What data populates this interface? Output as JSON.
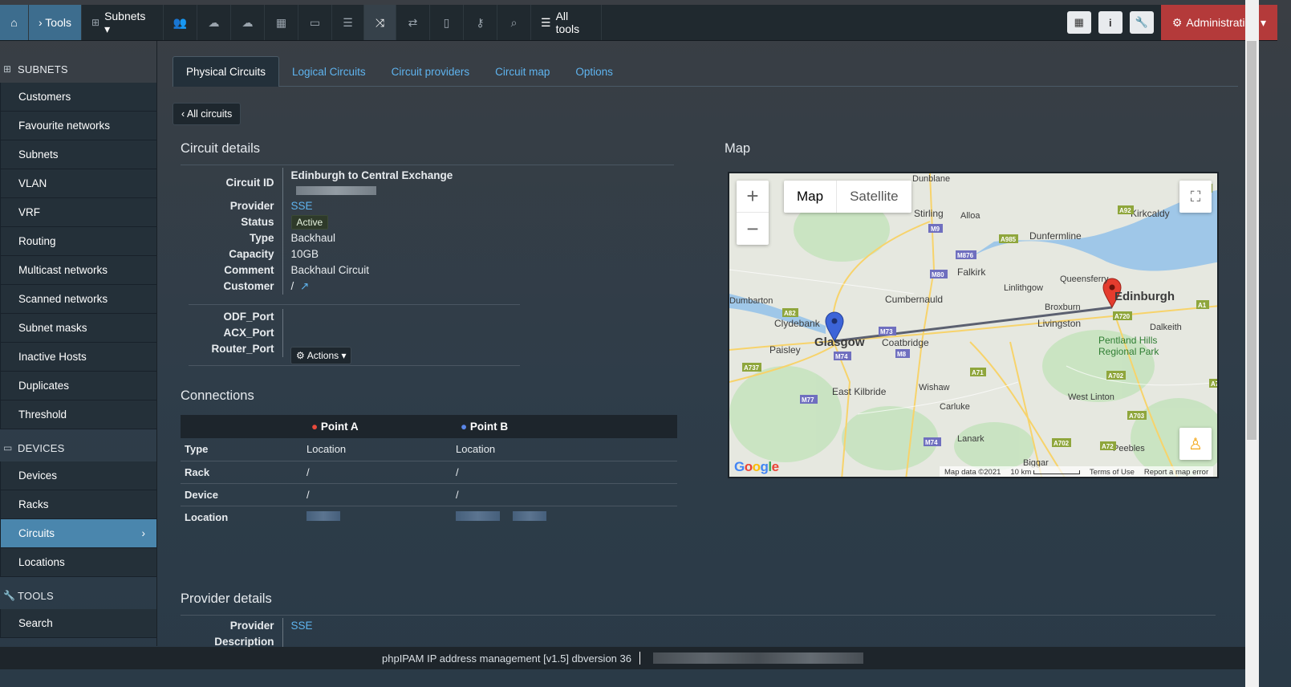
{
  "topbar": {
    "home_icon": "home-icon",
    "tools_label": "› Tools",
    "subnets_label": "Subnets ▾",
    "all_tools_label": "All tools",
    "admin_label": "Administration ▾",
    "icons": [
      "users-icon",
      "cloud-icon",
      "cloud-icon",
      "map-icon",
      "desktop-icon",
      "list-icon",
      "shuffle-icon",
      "exchange-icon",
      "map-outline-icon",
      "key-icon",
      "search-icon"
    ]
  },
  "sidebar": {
    "subnets_section": "SUBNETS",
    "subnets_items": [
      "Customers",
      "Favourite networks",
      "Subnets",
      "VLAN",
      "VRF",
      "Routing",
      "Multicast networks",
      "Scanned networks",
      "Subnet masks",
      "Inactive Hosts",
      "Duplicates",
      "Threshold"
    ],
    "devices_section": "DEVICES",
    "devices_items": [
      "Devices",
      "Racks",
      "Circuits",
      "Locations"
    ],
    "tools_section": "TOOLS",
    "tools_items": [
      "Search"
    ]
  },
  "tabs": [
    "Physical Circuits",
    "Logical Circuits",
    "Circuit providers",
    "Circuit map",
    "Options"
  ],
  "back_label": "‹ All circuits",
  "circuit": {
    "heading": "Circuit details",
    "labels": {
      "id": "Circuit ID",
      "provider": "Provider",
      "status": "Status",
      "type": "Type",
      "capacity": "Capacity",
      "comment": "Comment",
      "customer": "Customer",
      "odf": "ODF_Port",
      "acx": "ACX_Port",
      "router": "Router_Port"
    },
    "id": "Edinburgh to Central Exchange",
    "provider": "SSE",
    "status": "Active",
    "type": "Backhaul",
    "capacity": "10GB",
    "comment": "Backhaul Circuit",
    "customer": "/",
    "actions_label": "Actions ▾"
  },
  "connections": {
    "heading": "Connections",
    "point_a": "Point A",
    "point_b": "Point B",
    "rows": [
      {
        "label": "Type",
        "a": "Location",
        "b": "Location"
      },
      {
        "label": "Rack",
        "a": "/",
        "b": "/"
      },
      {
        "label": "Device",
        "a": "/",
        "b": "/"
      },
      {
        "label": "Location",
        "a": "",
        "b": ""
      }
    ]
  },
  "map": {
    "heading": "Map",
    "map_btn": "Map",
    "satellite_btn": "Satellite",
    "zoom_in": "+",
    "zoom_out": "−",
    "attribution": "Map data ©2021",
    "scale": "10 km",
    "terms": "Terms of Use",
    "report": "Report a map error",
    "places": {
      "glasgow": "Glasgow",
      "edinburgh": "Edinburgh",
      "stirling": "Stirling",
      "alloa": "Alloa",
      "dunfermline": "Dunfermline",
      "kirkcaldy": "Kirkcaldy",
      "falkirk": "Falkirk",
      "linlithgow": "Linlithgow",
      "queensferry": "Queensferry",
      "broxburn": "Broxburn",
      "livingston": "Livingston",
      "dalkeith": "Dalkeith",
      "pentland": "Pentland Hills",
      "regional_park": "Regional Park",
      "dumbarton": "Dumbarton",
      "clydebank": "Clydebank",
      "paisley": "Paisley",
      "cumbernauld": "Cumbernauld",
      "coatbridge": "Coatbridge",
      "east_kilbride": "East Kilbride",
      "wishaw": "Wishaw",
      "carluke": "Carluke",
      "lanark": "Lanark",
      "west_linton": "West Linton",
      "peebles": "Peebles",
      "biggar": "Biggar",
      "dunblane": "Dunblane"
    },
    "google": "Google"
  },
  "provider_details": {
    "heading": "Provider details",
    "provider_label": "Provider",
    "provider": "SSE",
    "description_label": "Description"
  },
  "footer": "phpIPAM IP address management [v1.5] dbversion 36"
}
